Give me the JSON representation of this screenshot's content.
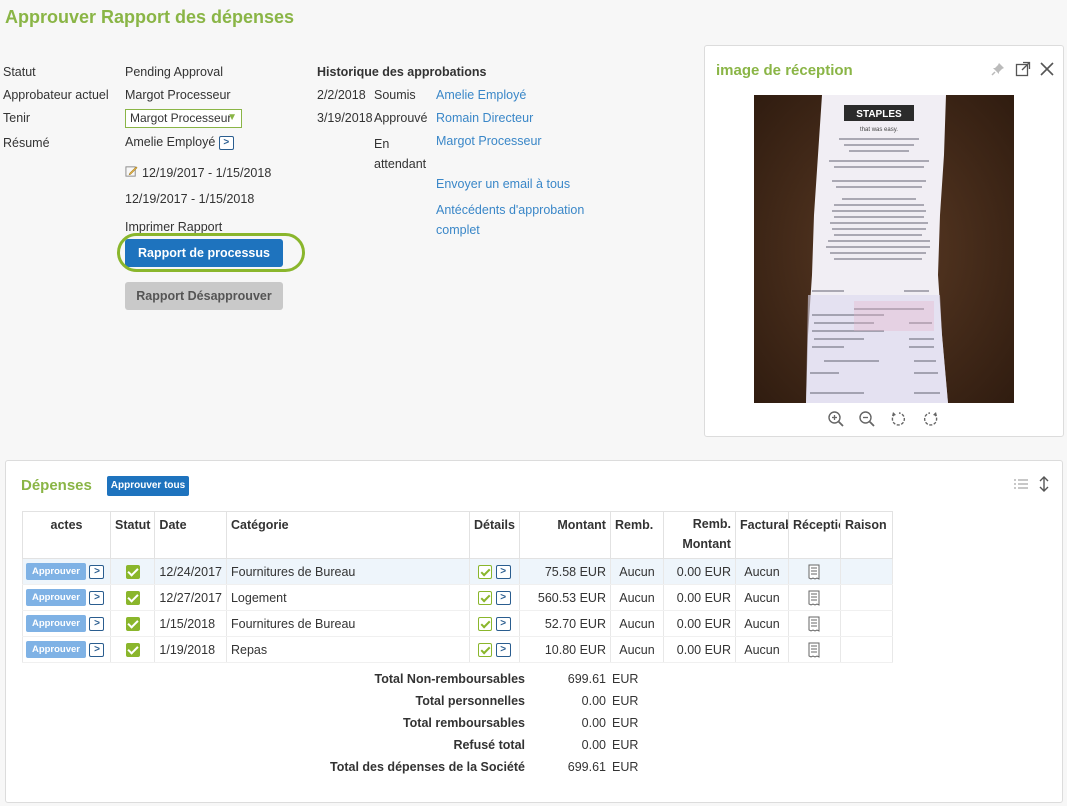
{
  "page_title": "Approuver Rapport des dépenses",
  "summary": {
    "status_label": "Statut",
    "status_value": "Pending Approval",
    "approver_label": "Approbateur actuel",
    "approver_value": "Margot Processeur",
    "hold_label": "Tenir",
    "hold_value": "Margot Processeur",
    "resume_label": "Résumé",
    "resume_value": "Amelie Employé",
    "period_edit": "12/19/2017 - 1/15/2018",
    "period": "12/19/2017 - 1/15/2018",
    "print_link": "Imprimer Rapport",
    "process_button": "Rapport de processus",
    "disapprove_button": "Rapport Désapprouver"
  },
  "history": {
    "title": "Historique des approbations",
    "rows": [
      {
        "date": "2/2/2018",
        "action": "Soumis",
        "who": "Amelie Employé"
      },
      {
        "date": "3/19/2018",
        "action": "Approuvé",
        "who": "Romain Directeur"
      },
      {
        "date": "",
        "action": "En attendant",
        "who": "Margot Processeur"
      }
    ],
    "email_link": "Envoyer un email à tous",
    "full_history_link": "Antécédents d'approbation complet"
  },
  "receipt": {
    "title": "image de réception",
    "store": "STAPLES",
    "slogan": "that was easy.",
    "icons": [
      "pin-icon",
      "external-link-icon",
      "close-icon"
    ],
    "tools": [
      "zoom-in-icon",
      "zoom-out-icon",
      "rotate-left-icon",
      "rotate-right-icon"
    ]
  },
  "expenses": {
    "title": "Dépenses",
    "approve_all": "Approuver tous",
    "columns": [
      "actes",
      "Statut",
      "Date",
      "Catégorie",
      "Détails",
      "Montant",
      "Remb.",
      "Remb. Montant",
      "Facturab",
      "Réceptio",
      "Raison"
    ],
    "approve_label": "Approuver",
    "rows": [
      {
        "date": "12/24/2017",
        "category": "Fournitures de Bureau",
        "amount": "75.58 EUR",
        "remb": "Aucun",
        "remb_amount": "0.00 EUR",
        "billable": "Aucun"
      },
      {
        "date": "12/27/2017",
        "category": "Logement",
        "amount": "560.53 EUR",
        "remb": "Aucun",
        "remb_amount": "0.00 EUR",
        "billable": "Aucun"
      },
      {
        "date": "1/15/2018",
        "category": "Fournitures de Bureau",
        "amount": "52.70 EUR",
        "remb": "Aucun",
        "remb_amount": "0.00 EUR",
        "billable": "Aucun"
      },
      {
        "date": "1/19/2018",
        "category": "Repas",
        "amount": "10.80 EUR",
        "remb": "Aucun",
        "remb_amount": "0.00 EUR",
        "billable": "Aucun"
      }
    ],
    "totals": [
      {
        "label": "Total Non-remboursables",
        "value": "699.61",
        "currency": "EUR"
      },
      {
        "label": "Total personnelles",
        "value": "0.00",
        "currency": "EUR"
      },
      {
        "label": "Total remboursables",
        "value": "0.00",
        "currency": "EUR"
      },
      {
        "label": "Refusé total",
        "value": "0.00",
        "currency": "EUR"
      },
      {
        "label": "Total des dépenses de la Société",
        "value": "699.61",
        "currency": "EUR"
      }
    ]
  },
  "colors": {
    "accent_green": "#8ab546",
    "primary_blue": "#1e73be",
    "link_blue": "#3a87c8"
  }
}
